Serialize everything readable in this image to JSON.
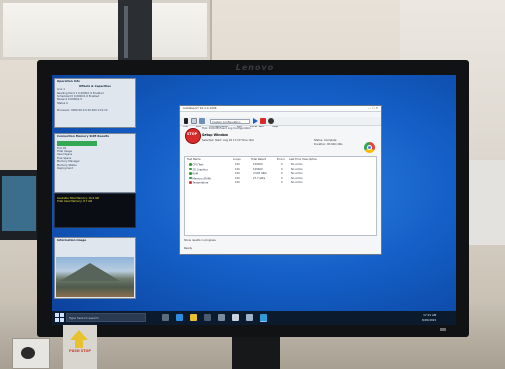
{
  "monitor": {
    "brand": "Lenovo"
  },
  "left_panels": {
    "panel1": {
      "title": "Operation Info",
      "subtitle": "Offsets & Capacities",
      "lines": [
        "Line 1",
        "Reading Point  1    0.0000/1.0   Enabled",
        "Scheduled      0    0.0000/1.0   Enabled",
        "Pause          0    0.0000/1.0",
        "Status         0"
      ],
      "footer": "Processor: 0000.00.0.0 00.000 13.0.10"
    },
    "panel2": {
      "title": "Connection  Memory SIZE  Results",
      "items": [
        "Tool #1",
        "Total Usage",
        "Used Space",
        "Free Space",
        "Memory Manager",
        "Memory Status",
        "Deployment"
      ]
    },
    "panel3": {
      "lines": [
        "Available Total Memory: 16.0 GB",
        "Total Used Memory: 8.7 GB"
      ]
    },
    "panel4": {
      "title": "Information  Image"
    }
  },
  "app": {
    "title": "AutoReport 10.2.0.1006",
    "window_controls": "—  ☐  ✕",
    "menu": [
      "File",
      "Edit",
      "Configuration",
      "Tool",
      "Excel Test",
      "Help"
    ],
    "toolbar_combo": "Custom Configuration",
    "stop_badge": "STOP",
    "tabs": "Tool: 0.00.00    Event Log    Configuration",
    "status_heading": "Setup Window",
    "info_row": "Selected:   Start: Aug 20 17:20  Time: N/A",
    "info_right": [
      "Status:  Complete",
      "Duration: 0h:00m:00s"
    ],
    "table": {
      "headers": [
        "Test Name",
        "Loops",
        "Total Result",
        "Errors",
        "Last Error Description"
      ],
      "rows": [
        {
          "name": "CPU Test",
          "loops": "100",
          "result": "100000",
          "errors": "0",
          "desc": "No errors",
          "color": "#2e9a3a"
        },
        {
          "name": "2D Graphics",
          "loops": "100",
          "result": "100000",
          "errors": "0",
          "desc": "No errors",
          "color": "#2e9a3a"
        },
        {
          "name": "RAM",
          "loops": "100",
          "result": "3.000 GB/s",
          "errors": "0",
          "desc": "No errors",
          "color": "#2e9a3a"
        },
        {
          "name": "Memory (RAM)",
          "loops": "100",
          "result": "27.7 GB/s",
          "errors": "0",
          "desc": "No errors",
          "color": "#2e9a3a"
        },
        {
          "name": "Temperature",
          "loops": "100",
          "result": "",
          "errors": "0",
          "desc": "No errors",
          "color": "#d83a3a"
        }
      ]
    },
    "footer1": "Show results in progress",
    "footer2": "Ready"
  },
  "taskbar": {
    "search_placeholder": "Type here to search",
    "time": "17:21 AM",
    "date": "8/20/2021"
  },
  "sticker": {
    "label": "PUSH STOP"
  },
  "colors": {
    "desktop": "#1460c8",
    "stop": "#d92a2a",
    "ok": "#2e9a3a",
    "taskbar": "#0c1a2e"
  }
}
